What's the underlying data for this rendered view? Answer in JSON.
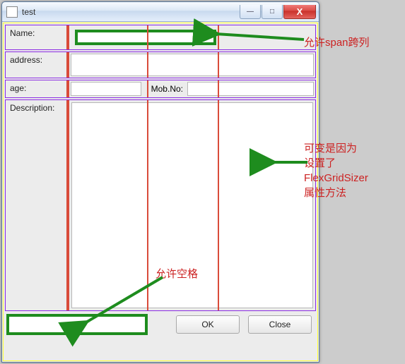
{
  "window": {
    "title": "test"
  },
  "winbuttons": {
    "min": "—",
    "max": "□",
    "close": "X"
  },
  "form": {
    "name_label": "Name:",
    "name_value": "",
    "address_label": "address:",
    "address_value": "",
    "age_label": "age:",
    "age_value": "",
    "mob_label": "Mob.No:",
    "mob_value": "",
    "desc_label": "Description:",
    "desc_value": ""
  },
  "buttons": {
    "ok": "OK",
    "close": "Close"
  },
  "annotations": {
    "span_columns": "允许span跨列",
    "flex_grid": "可变是因为\n设置了\nFlexGridSizer\n属性方法",
    "allow_blank": "允许空格"
  },
  "colors": {
    "grid_purple": "#8a2be2",
    "grid_red": "#d94b3a",
    "grid_yellow": "#ffff33",
    "highlight_green": "#1e8c1e",
    "annotation_red": "#c22"
  }
}
